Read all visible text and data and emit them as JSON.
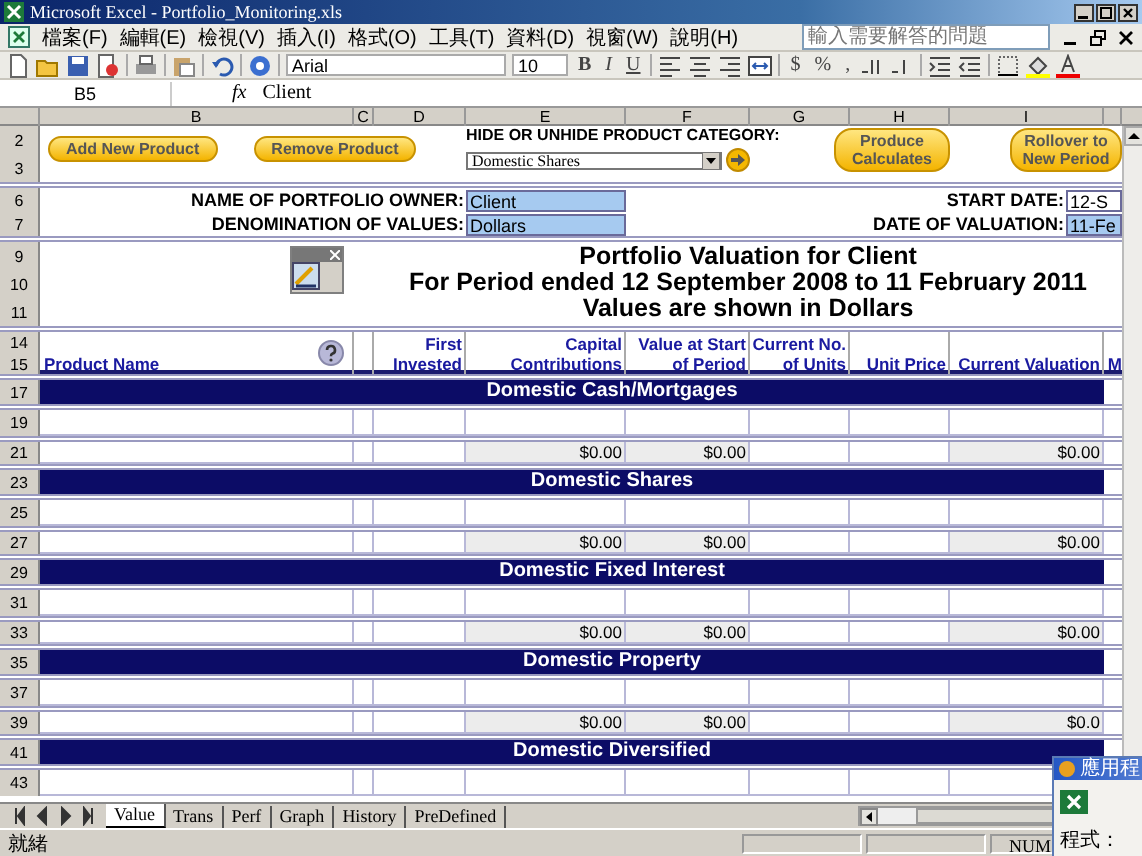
{
  "window": {
    "title": "Microsoft Excel - Portfolio_Monitoring.xls"
  },
  "menu": [
    "檔案(F)",
    "編輯(E)",
    "檢視(V)",
    "插入(I)",
    "格式(O)",
    "工具(T)",
    "資料(D)",
    "視窗(W)",
    "說明(H)"
  ],
  "help_box": {
    "placeholder": "輸入需要解答的問題"
  },
  "toolbar": {
    "font": "Arial",
    "size": "10",
    "style_buttons": [
      "B",
      "I",
      "U"
    ],
    "number_buttons": [
      "$",
      "%",
      ","
    ]
  },
  "formula_bar": {
    "name_box": "B5",
    "function_label": "fx",
    "value": "Client"
  },
  "columns": [
    "B",
    "C",
    "D",
    "E",
    "F",
    "G",
    "H",
    "I"
  ],
  "sheet": [
    {
      "kind": "buttons",
      "rows": [
        "2",
        "3"
      ],
      "add_button": "Add New Product",
      "remove_button": "Remove Product",
      "category_label": "HIDE OR UNHIDE PRODUCT CATEGORY:",
      "category_value": "Domestic Shares",
      "calc_button": "Produce Calculates",
      "rollover_button": "Rollover to New Period"
    },
    {
      "kind": "info",
      "rows": [
        "6",
        "7"
      ],
      "lines": [
        {
          "label": "NAME OF PORTFOLIO OWNER:",
          "value": "Client",
          "highlighted": true,
          "right_label": "START DATE:",
          "right_value": "12-S",
          "right_highlighted": false
        },
        {
          "label": "DENOMINATION OF VALUES:",
          "value": "Dollars",
          "highlighted": true,
          "right_label": "DATE OF VALUATION:",
          "right_value": "11-Fe",
          "right_highlighted": true
        }
      ]
    },
    {
      "kind": "title",
      "rows": [
        "9",
        "10",
        "11"
      ],
      "lines": [
        "Portfolio Valuation for Client",
        "For Period ended 12 September 2008 to 11 February 2011",
        "Values are shown in Dollars"
      ]
    },
    {
      "kind": "header",
      "rows": [
        "14",
        "15"
      ],
      "cells": [
        {
          "kind": "product",
          "text": "Product Name"
        },
        {
          "kind": "empty"
        },
        {
          "kind": "heading",
          "text": "First Invested"
        },
        {
          "kind": "heading",
          "text": "Capital Contributions"
        },
        {
          "kind": "heading",
          "text": "Value at Start of Period"
        },
        {
          "kind": "heading",
          "text": "Current No. of Units"
        },
        {
          "kind": "heading",
          "text": "Unit Price"
        },
        {
          "kind": "heading",
          "text": "Current Valuation"
        }
      ],
      "next_column_text": "M"
    },
    {
      "kind": "band",
      "rows": [
        "17"
      ],
      "title": "Domestic Cash/Mortgages"
    },
    {
      "kind": "blank",
      "rows": [
        "19"
      ]
    },
    {
      "kind": "total",
      "rows": [
        "21"
      ],
      "cells": [
        {
          "kind": "empty"
        },
        {
          "kind": "empty"
        },
        {
          "kind": "empty"
        },
        {
          "kind": "amount",
          "text": "$0.00"
        },
        {
          "kind": "amount",
          "text": "$0.00"
        },
        {
          "kind": "empty"
        },
        {
          "kind": "empty"
        },
        {
          "kind": "amount",
          "text": "$0.00"
        }
      ]
    },
    {
      "kind": "band",
      "rows": [
        "23"
      ],
      "title": "Domestic Shares"
    },
    {
      "kind": "blank",
      "rows": [
        "25"
      ]
    },
    {
      "kind": "total",
      "rows": [
        "27"
      ],
      "cells": [
        {
          "kind": "empty"
        },
        {
          "kind": "empty"
        },
        {
          "kind": "empty"
        },
        {
          "kind": "amount",
          "text": "$0.00"
        },
        {
          "kind": "amount",
          "text": "$0.00"
        },
        {
          "kind": "empty"
        },
        {
          "kind": "empty"
        },
        {
          "kind": "amount",
          "text": "$0.00"
        }
      ]
    },
    {
      "kind": "band",
      "rows": [
        "29"
      ],
      "title": "Domestic Fixed Interest"
    },
    {
      "kind": "blank",
      "rows": [
        "31"
      ]
    },
    {
      "kind": "total",
      "rows": [
        "33"
      ],
      "cells": [
        {
          "kind": "empty"
        },
        {
          "kind": "empty"
        },
        {
          "kind": "empty"
        },
        {
          "kind": "amount",
          "text": "$0.00"
        },
        {
          "kind": "amount",
          "text": "$0.00"
        },
        {
          "kind": "empty"
        },
        {
          "kind": "empty"
        },
        {
          "kind": "amount",
          "text": "$0.00"
        }
      ]
    },
    {
      "kind": "band",
      "rows": [
        "35"
      ],
      "title": "Domestic Property"
    },
    {
      "kind": "blank",
      "rows": [
        "37"
      ]
    },
    {
      "kind": "total",
      "rows": [
        "39"
      ],
      "cells": [
        {
          "kind": "empty"
        },
        {
          "kind": "empty"
        },
        {
          "kind": "empty"
        },
        {
          "kind": "amount",
          "text": "$0.00"
        },
        {
          "kind": "amount",
          "text": "$0.00"
        },
        {
          "kind": "empty"
        },
        {
          "kind": "empty"
        },
        {
          "kind": "amount",
          "text": "$0.0"
        }
      ]
    },
    {
      "kind": "band",
      "rows": [
        "41"
      ],
      "title": "Domestic Diversified"
    },
    {
      "kind": "blank",
      "rows": [
        "43"
      ]
    }
  ],
  "sheet_tabs": [
    {
      "label": "Value",
      "selected": true
    },
    {
      "label": "Trans",
      "selected": false
    },
    {
      "label": "Perf",
      "selected": false
    },
    {
      "label": "Graph",
      "selected": false
    },
    {
      "label": "History",
      "selected": false
    },
    {
      "label": "PreDefined",
      "selected": false
    }
  ],
  "status_bar": {
    "state": "就緒",
    "indicator": "NUM"
  },
  "popup": {
    "title": "應用程",
    "label": "程式："
  }
}
